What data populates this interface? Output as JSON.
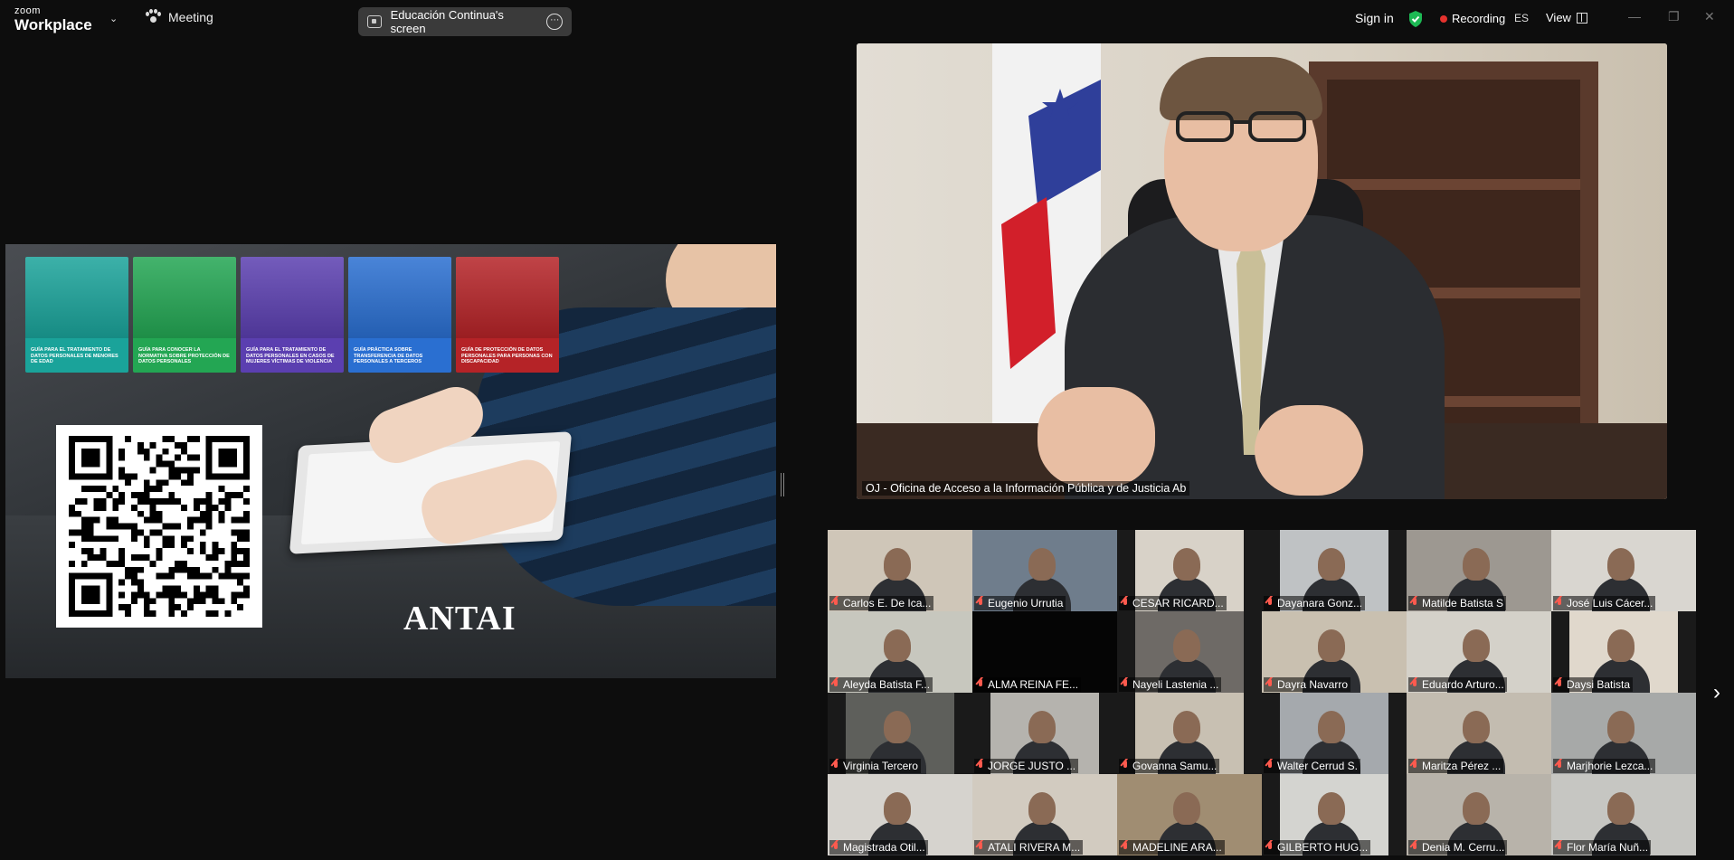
{
  "app": {
    "brand_small": "zoom",
    "brand_large": "Workplace",
    "meeting_label": "Meeting",
    "share_indicator": "Educación Continua's screen",
    "sign_in": "Sign in",
    "recording": "Recording",
    "language": "ES",
    "view": "View"
  },
  "shared_screen": {
    "guides": [
      {
        "text": "Guía para el tratamiento de datos personales de menores de edad",
        "color": "#1aa39a"
      },
      {
        "text": "Guía para conocer la normativa sobre protección de datos personales",
        "color": "#23a653"
      },
      {
        "text": "Guía para el tratamiento de datos personales en casos de mujeres víctimas de violencia",
        "color": "#5b3fb0"
      },
      {
        "text": "Guía práctica sobre transferencia de datos personales a terceros",
        "color": "#2a6fd1"
      },
      {
        "text": "Guía de protección de datos personales para personas con discapacidad",
        "color": "#b52327"
      }
    ],
    "brand_text": "ANTAI"
  },
  "speaker": {
    "name": "OJ - Oficina de Acceso a la Información Pública y de Justicia Ab"
  },
  "participants": [
    {
      "name": "Carlos E. De Ica...",
      "bg": "#cfc6b8"
    },
    {
      "name": "Eugenio Urrutia",
      "bg": "#6f7d8c"
    },
    {
      "name": "CESAR RICARD...",
      "bg": "#d8d2c8"
    },
    {
      "name": "Dayanara Gonz...",
      "bg": "#bfc2c4"
    },
    {
      "name": "Matilde Batista S",
      "bg": "#9d9891"
    },
    {
      "name": "José Luis Cácer...",
      "bg": "#d9d6d0"
    },
    {
      "name": "Aleyda Batista F...",
      "bg": "#c7c7be"
    },
    {
      "name": "ALMA REINA FE...",
      "bg": "#050505"
    },
    {
      "name": "Nayeli Lastenia ...",
      "bg": "#6e6a66"
    },
    {
      "name": "Dayra Navarro",
      "bg": "#c9c0b0"
    },
    {
      "name": "Eduardo Arturo...",
      "bg": "#d4d1c9"
    },
    {
      "name": "Daysi Batista",
      "bg": "#e0d8cc"
    },
    {
      "name": "Virginia Tercero",
      "bg": "#5e5f5b"
    },
    {
      "name": "JORGE JUSTO ...",
      "bg": "#b5b3ae"
    },
    {
      "name": "Govanna Samu...",
      "bg": "#c8c0b2"
    },
    {
      "name": "Walter Cerrud S.",
      "bg": "#a5a9ad"
    },
    {
      "name": "Maritza Pérez ...",
      "bg": "#c3bcb0"
    },
    {
      "name": "Marjhorie Lezca...",
      "bg": "#a7a9a8"
    },
    {
      "name": "Magistrada Otil...",
      "bg": "#d6d3ce"
    },
    {
      "name": "ATALI RIVERA M...",
      "bg": "#d2cbc0"
    },
    {
      "name": "MADELINE ARA...",
      "bg": "#a08d72"
    },
    {
      "name": "GILBERTO HUG...",
      "bg": "#d4d4d0"
    },
    {
      "name": "Denia M. Cerru...",
      "bg": "#b8b3aa"
    },
    {
      "name": "Flor María Nuñ...",
      "bg": "#c6c6c2"
    }
  ]
}
